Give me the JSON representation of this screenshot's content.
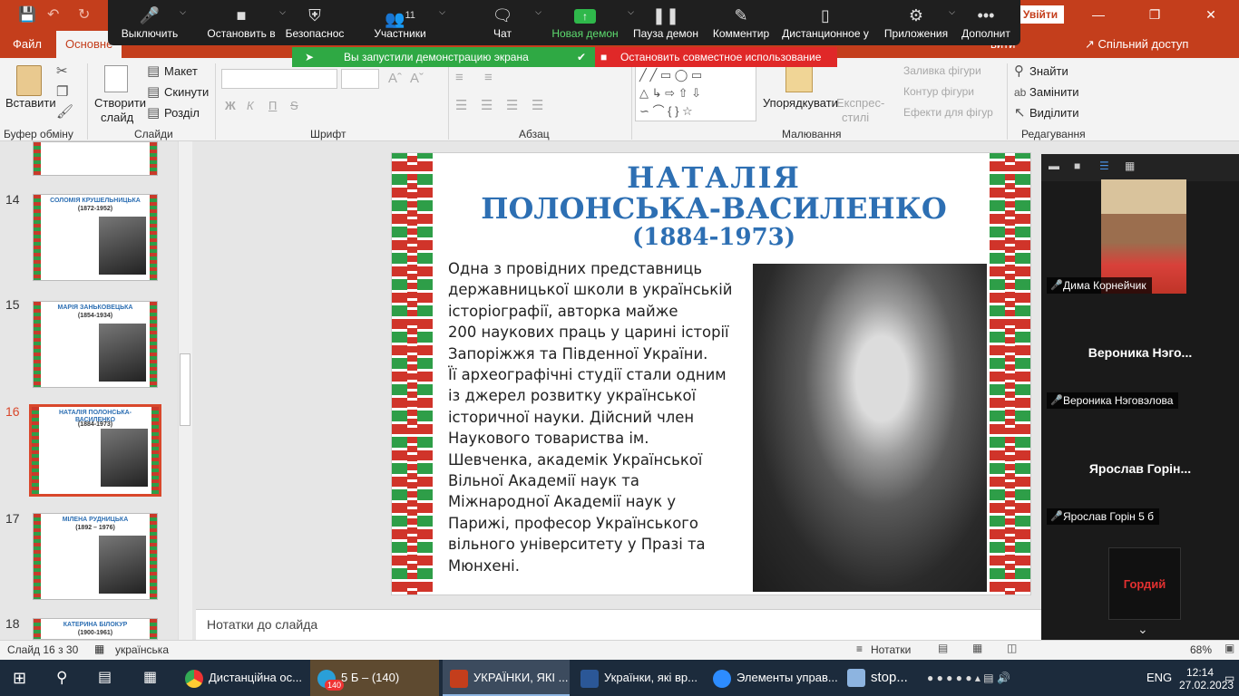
{
  "zoom": {
    "buttons": [
      {
        "label": "Выключить",
        "icon": "microphone-icon"
      },
      {
        "label": "Остановить в",
        "icon": "video-camera-icon"
      },
      {
        "label": "Безопаснос",
        "icon": "shield-icon"
      },
      {
        "label": "Участники",
        "icon": "participants-icon",
        "count": "11"
      },
      {
        "label": "Чат",
        "icon": "chat-icon"
      },
      {
        "label": "Новая демон",
        "icon": "share-screen-icon"
      },
      {
        "label": "Пауза демон",
        "icon": "pause-icon"
      },
      {
        "label": "Комментир",
        "icon": "pencil-icon"
      },
      {
        "label": "Дистанционное у",
        "icon": "mouse-icon"
      },
      {
        "label": "Приложения",
        "icon": "apps-icon"
      },
      {
        "label": "Дополнит",
        "icon": "more-icon"
      }
    ],
    "share_notice": "Вы запустили демонстрацию экрана",
    "stop_share": "Остановить совместное использование",
    "participants": [
      {
        "name": "Дима Корнейчик",
        "has_video": true
      },
      {
        "name": "Вероника Нэговэлова",
        "display": "Вероника  Нэго..."
      },
      {
        "name": "Ярослав Горін 5 б",
        "display": "Ярослав  Горін..."
      },
      {
        "name": "Владимиров Гордий",
        "logo": "Гордий"
      }
    ]
  },
  "titlebar": {
    "signin": "Увійти",
    "colors": {
      "accent": "#c43e1c"
    }
  },
  "tabs": {
    "file": "Файл",
    "home": "Основне",
    "draw": "вити",
    "share": "Спільний доступ"
  },
  "ribbon": {
    "clipboard": {
      "label": "Буфер обміну",
      "paste": "Вставити"
    },
    "slides": {
      "label": "Слайди",
      "new_slide": "Створити",
      "new_slide2": "слайд",
      "layout": "Макет",
      "reset": "Скинути",
      "section": "Розділ"
    },
    "font": {
      "label": "Шрифт",
      "bold": "Ж",
      "italic": "К",
      "underline": "П",
      "strike": "S"
    },
    "paragraph": {
      "label": "Абзац"
    },
    "drawing": {
      "label": "Малювання",
      "arrange": "Упорядкувати",
      "quick_styles": "Експрес-",
      "quick_styles2": "стилі",
      "fill": "Заливка фігури",
      "outline": "Контур фігури",
      "effects": "Ефекти для фігур"
    },
    "editing": {
      "label": "Редагування",
      "find": "Знайти",
      "replace": "Замінити",
      "select": "Виділити"
    }
  },
  "thumbnails": [
    {
      "num": "14",
      "title": "СОЛОМІЯ КРУШЕЛЬНИЦЬКА",
      "years": "(1872-1952)"
    },
    {
      "num": "15",
      "title": "МАРІЯ ЗАНЬКОВЕЦЬКА",
      "years": "(1854-1934)"
    },
    {
      "num": "16",
      "title": "НАТАЛІЯ ПОЛОНСЬКА-ВАСИЛЕНКО",
      "years": "(1884-1973)"
    },
    {
      "num": "17",
      "title": "МІЛЕНА РУДНИЦЬКА",
      "years": "(1892 – 1976)"
    },
    {
      "num": "18",
      "title": "КАТЕРИНА БІЛОКУР",
      "years": "(1900-1961)"
    }
  ],
  "slide": {
    "title1": "НАТАЛІЯ",
    "title2": "ПОЛОНСЬКА-ВАСИЛЕНКО",
    "title3": "(1884-1973)",
    "lines": [
      "Одна з провідних представниць",
      "державницької школи в українській",
      "історіографії, авторка майже",
      "200 наукових праць у царині історії",
      "Запоріжжя та Південної України.",
      "Її археографічні студії стали одним",
      "із джерел розвитку української",
      "історичної науки. Дійсний член",
      "Наукового товариства ім.",
      "Шевченка, академік Української",
      "Вільної Академії наук та",
      "Міжнародної Академії наук у",
      "Парижі, професор Українського",
      "вільного університету у Празі та",
      "Мюнхені."
    ]
  },
  "notes_placeholder": "Нотатки до слайда",
  "status": {
    "slide": "Слайд 16 з 30",
    "lang": "українська",
    "notes": "Нотатки",
    "zoom": "68%"
  },
  "taskbar": {
    "items": [
      "Дистанційна ос...",
      "5 Б – (140)",
      "УКРАЇНКИ, ЯКІ ...",
      "Українки, які вр...",
      "Элементы управ...",
      "stop..."
    ],
    "badge": "140",
    "lang": "ENG",
    "time": "12:14",
    "date": "27.02.2023"
  }
}
